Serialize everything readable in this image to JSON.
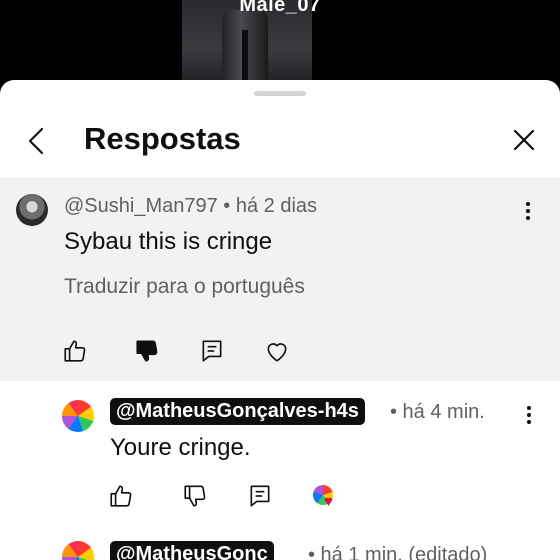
{
  "video": {
    "title": "Male_07"
  },
  "sheet": {
    "title": "Respostas"
  },
  "parent_comment": {
    "handle": "@Sushi_Man797",
    "time": "• há 2 dias",
    "text": "Sybau this is cringe",
    "translate_label": "Traduzir para o português",
    "disliked": true
  },
  "replies": [
    {
      "handle": "@MatheusGonçalves-h4s",
      "time": "• há 4 min.",
      "text": "Youre cringe.",
      "creator_heart": true
    },
    {
      "handle": "@MatheusGonç",
      "time": "• há 1 min. (editado)"
    }
  ],
  "icons": {
    "back": "chevron-left-icon",
    "close": "close-icon",
    "like": "thumbs-up-icon",
    "dislike": "thumbs-down-icon",
    "reply": "reply-icon",
    "heart": "heart-icon",
    "more": "more-vertical-icon"
  },
  "colors": {
    "sheet_bg": "#ffffff",
    "highlight_bg": "#f2f2f2",
    "meta_text": "#606060",
    "heart": "#ff0033"
  }
}
